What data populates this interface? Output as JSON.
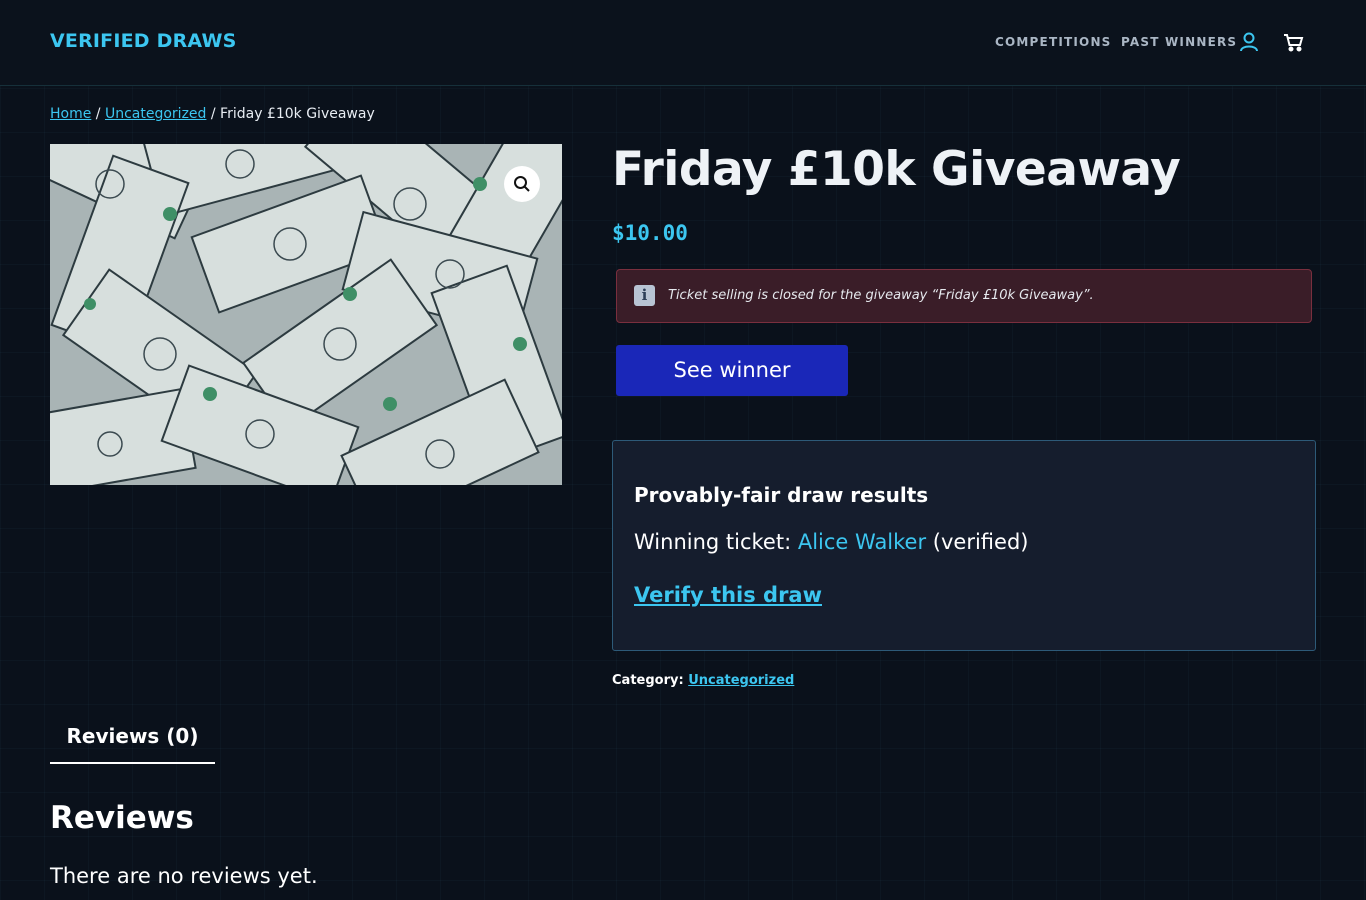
{
  "header": {
    "logo": "VERIFIED DRAWS",
    "nav": {
      "competitions": "COMPETITIONS",
      "past_winners": "PAST WINNERS"
    },
    "icons": {
      "account": "user-icon",
      "cart": "cart-icon"
    }
  },
  "breadcrumb": {
    "home": "Home",
    "sep1": " / ",
    "category": "Uncategorized",
    "sep2": " / ",
    "current": "Friday £10k Giveaway"
  },
  "product": {
    "title": "Friday £10k Giveaway",
    "price": "$10.00",
    "image_icon": "zoom-icon"
  },
  "notice": {
    "icon": "info-icon",
    "glyph": "i",
    "text": "Ticket selling is closed for the giveaway “Friday £10k Giveaway”."
  },
  "see_winner_label": "See winner",
  "draw_results": {
    "title": "Provably-fair draw results",
    "winning_label": "Winning ticket: ",
    "winner_name": "Alice Walker",
    "winner_suffix": " (verified)",
    "verify_link": "Verify this draw"
  },
  "category": {
    "label": "Category: ",
    "value": "Uncategorized"
  },
  "tabs": [
    {
      "label": "Reviews (0)"
    }
  ],
  "reviews": {
    "heading": "Reviews",
    "empty": "There are no reviews yet."
  },
  "colors": {
    "accent": "#3cc6f0",
    "button": "#1a27b8",
    "notice_bg": "#3a1d28",
    "page_bg": "#0a111b"
  }
}
